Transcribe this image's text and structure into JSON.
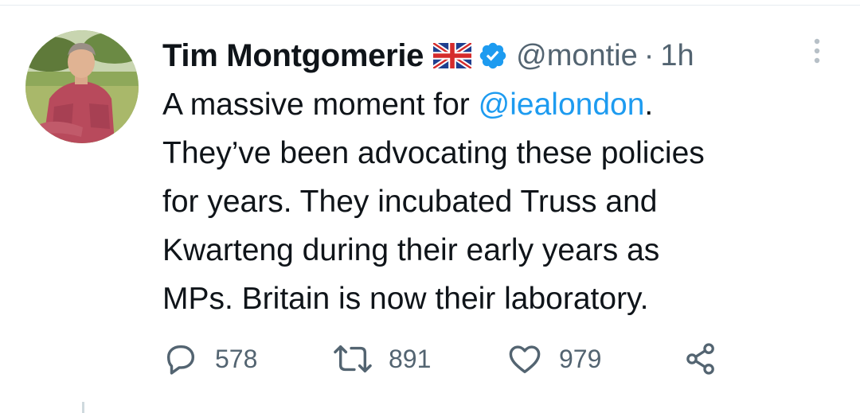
{
  "tweet": {
    "author": {
      "display_name": "Tim Montgomerie",
      "flag_icon": "uk-flag-emoji",
      "verified_icon": "verified-badge-icon",
      "handle": "@montie",
      "separator": "·",
      "timestamp": "1h"
    },
    "text": {
      "line1_prefix": "A massive moment for ",
      "line1_mention": "@iealondon",
      "line1_suffix": ".",
      "line2": "They’ve been advocating these policies",
      "line3": "for years. They incubated Truss and",
      "line4": "Kwarteng during their early years as",
      "line5": "MPs. Britain is now their laboratory."
    },
    "actions": {
      "replies": "578",
      "retweets": "891",
      "likes": "979"
    }
  },
  "colors": {
    "accent": "#1d9bf0",
    "text_primary": "#0f1419",
    "text_secondary": "#536471",
    "divider": "#e6ecf0"
  }
}
